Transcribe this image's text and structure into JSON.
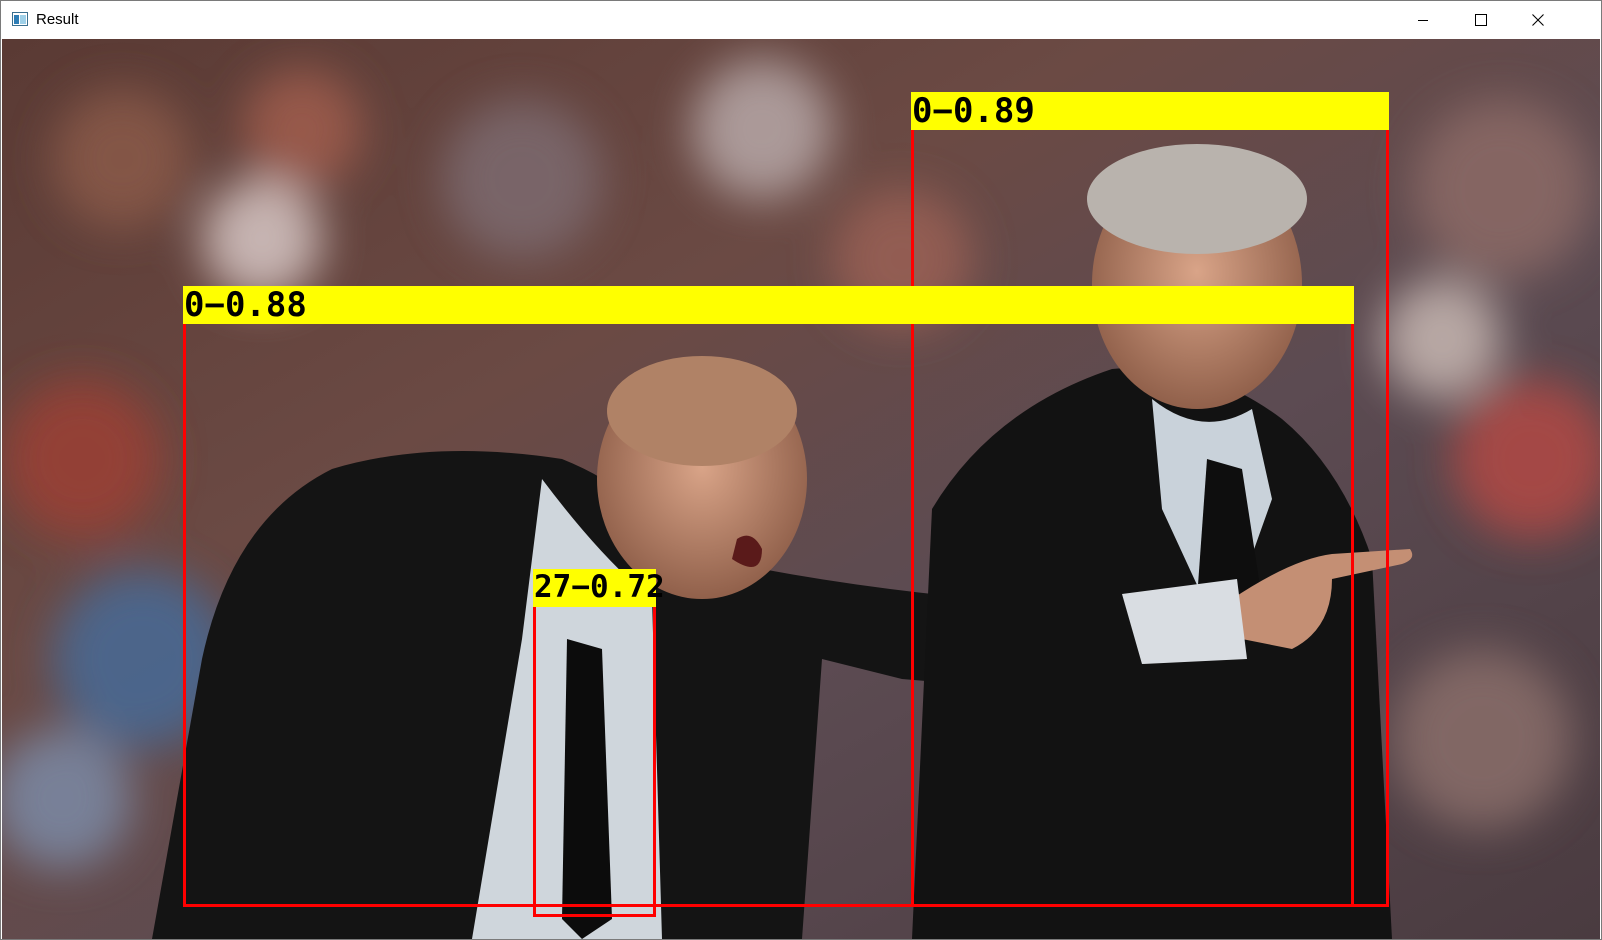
{
  "window": {
    "title": "Result",
    "icon": "opencv-window-icon",
    "controls": [
      "minimize-icon",
      "maximize-icon",
      "close-icon"
    ]
  },
  "detections": [
    {
      "class_id": "0",
      "score": "0.89",
      "text": "0−0.89"
    },
    {
      "class_id": "0",
      "score": "0.88",
      "text": "0−0.88"
    },
    {
      "class_id": "27",
      "score": "0.72",
      "text": "27−0.72"
    }
  ],
  "colors": {
    "box": "#ff0000",
    "label_bg": "#ffff00",
    "label_text": "#000000"
  }
}
